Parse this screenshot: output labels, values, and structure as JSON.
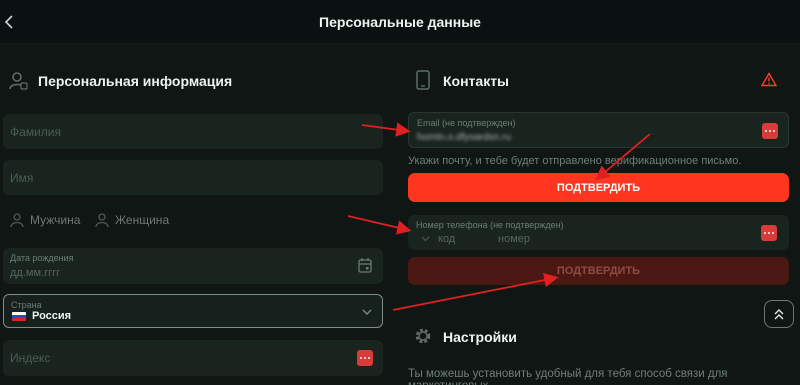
{
  "header": {
    "title": "Персональные данные"
  },
  "personal": {
    "title": "Персональная информация",
    "surname_placeholder": "Фамилия",
    "name_placeholder": "Имя",
    "gender_male": "Мужчина",
    "gender_female": "Женщина",
    "birth_label": "Дата рождения",
    "birth_placeholder": "дд.мм.гггг",
    "country_label": "Страна",
    "country_value": "Россия",
    "index_placeholder": "Индекс"
  },
  "contacts": {
    "title": "Контакты",
    "email_label": "Email (не подтвержден)",
    "email_value": "homtn.o.dfysardsn.ru",
    "email_hint": "Укажи почту, и тебе будет отправлено верификационное письмо.",
    "confirm_email_button": "ПОДТВЕРДИТЬ",
    "phone_label": "Номер телефона (не подтвержден)",
    "phone_code_placeholder": "код",
    "phone_number_placeholder": "номер",
    "confirm_phone_button": "ПОДТВЕРДИТЬ"
  },
  "settings": {
    "title": "Настройки",
    "hint": "Ты можешь установить удобный для тебя способ связи для маркетинговых"
  },
  "colors": {
    "background": "#0f1614",
    "field": "#19241f",
    "accent_red": "#ff3520",
    "disabled_red": "#4a1712",
    "country_border": "#7e8d87",
    "warning": "#ff3b2a"
  },
  "icons": {
    "back": "chevron-left-icon",
    "personal": "user-icon",
    "contacts": "phone-icon",
    "warning": "warning-triangle-icon",
    "settings": "gear-icon",
    "calendar": "calendar-icon",
    "scroll_top": "double-chevron-up-icon"
  }
}
